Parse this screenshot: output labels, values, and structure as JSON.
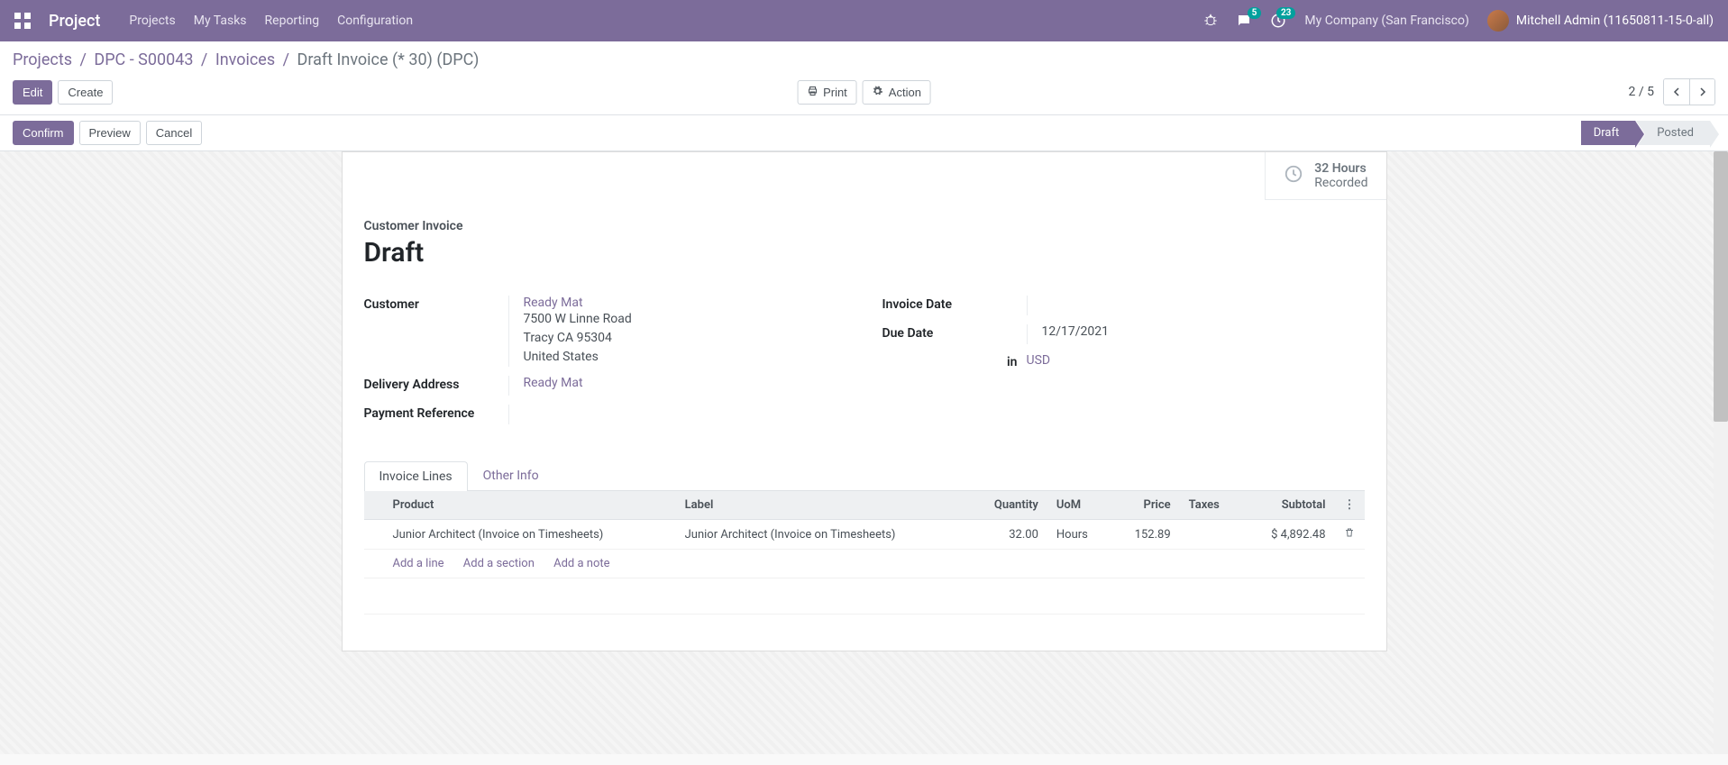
{
  "nav": {
    "brand": "Project",
    "items": [
      "Projects",
      "My Tasks",
      "Reporting",
      "Configuration"
    ],
    "messages_badge": "5",
    "activities_badge": "23",
    "company": "My Company (San Francisco)",
    "user": "Mitchell Admin (11650811-15-0-all)"
  },
  "breadcrumbs": {
    "parts": [
      "Projects",
      "DPC - S00043",
      "Invoices"
    ],
    "current": "Draft Invoice (* 30) (DPC)"
  },
  "buttons": {
    "edit": "Edit",
    "create": "Create",
    "print": "Print",
    "action": "Action",
    "confirm": "Confirm",
    "preview": "Preview",
    "cancel": "Cancel"
  },
  "pager": {
    "text": "2 / 5"
  },
  "stages": {
    "draft": "Draft",
    "posted": "Posted"
  },
  "stat": {
    "value": "32 Hours",
    "label": "Recorded"
  },
  "title": {
    "type": "Customer Invoice",
    "name": "Draft"
  },
  "fields": {
    "customer_label": "Customer",
    "customer_name": "Ready Mat",
    "addr1": "7500 W Linne Road",
    "addr2": "Tracy CA 95304",
    "addr3": "United States",
    "delivery_label": "Delivery Address",
    "delivery_value": "Ready Mat",
    "payment_ref_label": "Payment Reference",
    "invoice_date_label": "Invoice Date",
    "due_date_label": "Due Date",
    "due_date_value": "12/17/2021",
    "currency_in": "in",
    "currency": "USD"
  },
  "tabs": {
    "lines": "Invoice Lines",
    "other": "Other Info"
  },
  "table": {
    "headers": {
      "product": "Product",
      "label": "Label",
      "quantity": "Quantity",
      "uom": "UoM",
      "price": "Price",
      "taxes": "Taxes",
      "subtotal": "Subtotal"
    },
    "row": {
      "product": "Junior Architect (Invoice on Timesheets)",
      "label": "Junior Architect (Invoice on Timesheets)",
      "quantity": "32.00",
      "uom": "Hours",
      "price": "152.89",
      "taxes": "",
      "subtotal": "$ 4,892.48"
    },
    "add_line": "Add a line",
    "add_section": "Add a section",
    "add_note": "Add a note"
  }
}
